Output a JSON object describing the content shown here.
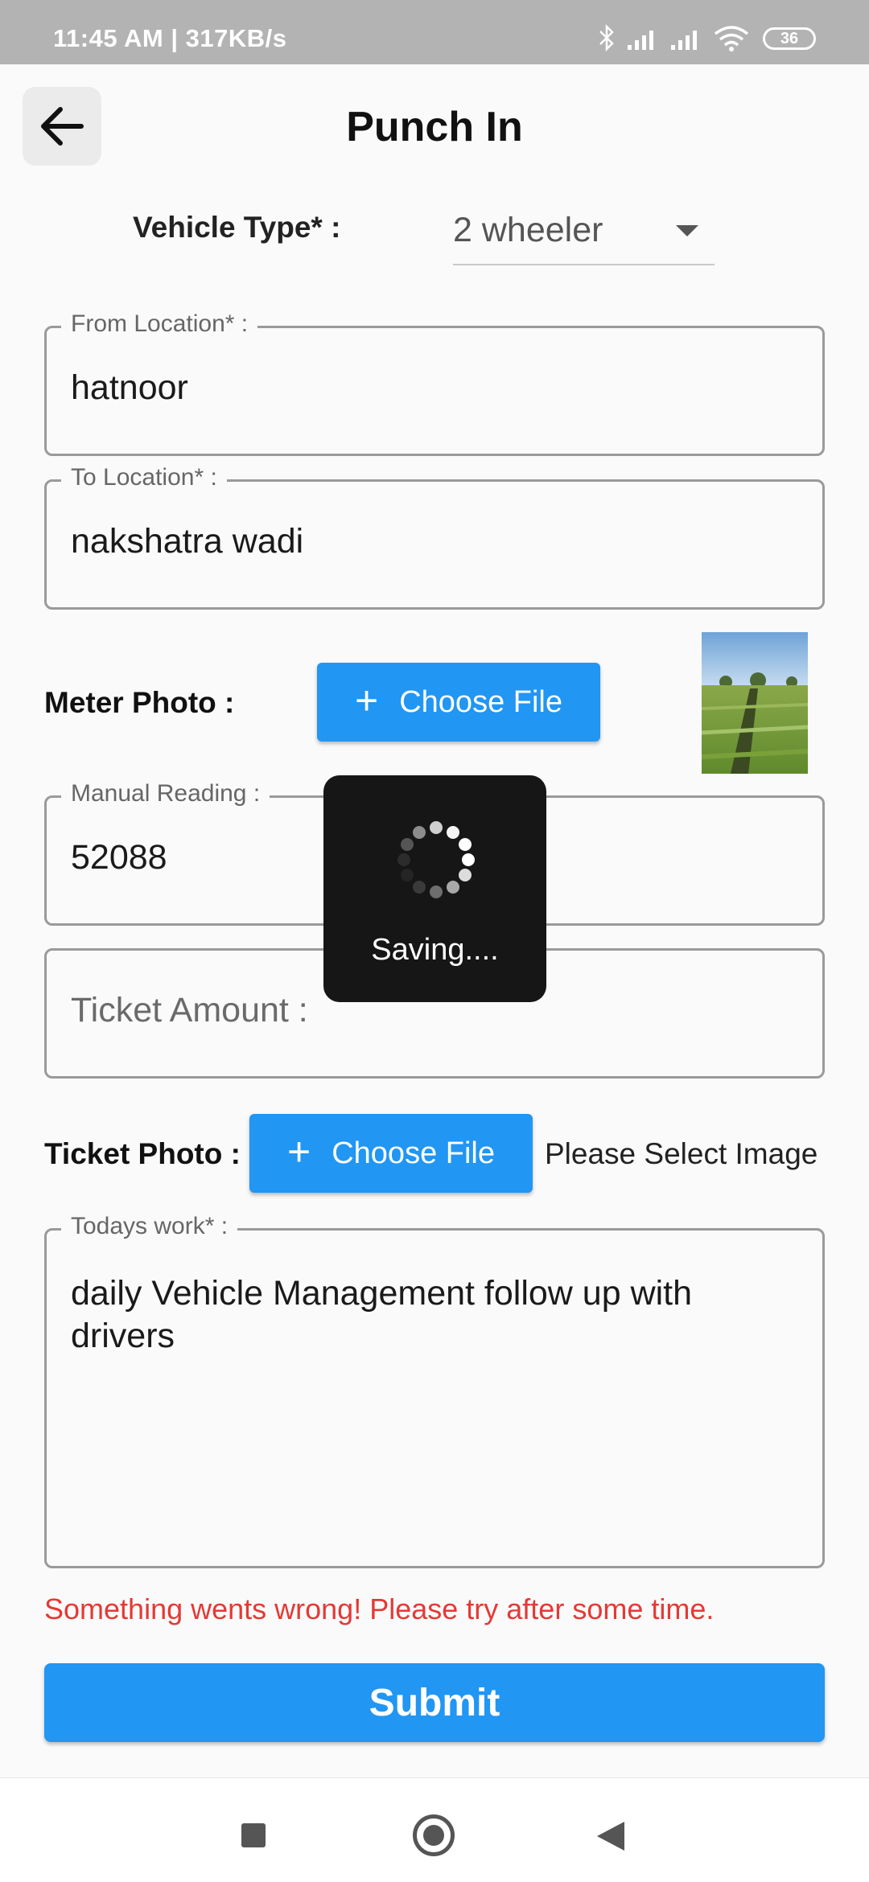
{
  "status_bar": {
    "time": "11:45 AM | 317KB/s",
    "battery": "36",
    "icons": [
      "bluetooth-icon",
      "signal-icon",
      "signal-icon",
      "wifi-icon",
      "battery-icon"
    ]
  },
  "header": {
    "title": "Punch In",
    "back_icon": "arrow-left-icon"
  },
  "vehicle": {
    "label": "Vehicle Type* :",
    "value": "2 wheeler"
  },
  "from_location": {
    "label": "From Location* :",
    "value": "hatnoor"
  },
  "to_location": {
    "label": "To Location* :",
    "value": "nakshatra wadi"
  },
  "meter_photo": {
    "label": "Meter Photo :",
    "button_label": "Choose File"
  },
  "manual_reading": {
    "label": "Manual Reading :",
    "value": "52088"
  },
  "ticket_amount": {
    "placeholder": "Ticket Amount :"
  },
  "ticket_photo": {
    "label": "Ticket Photo :",
    "button_label": "Choose File",
    "status": "Please Select Image"
  },
  "todays_work": {
    "label": "Todays work* :",
    "value": "daily Vehicle Management follow up with drivers"
  },
  "error_message": "Something wents wrong! Please try after some time.",
  "submit_label": "Submit",
  "loading": {
    "text": "Saving...."
  },
  "colors": {
    "primary": "#2196f3",
    "error": "#e53935",
    "overlay": "#161616",
    "status_bar": "#b3b3b3"
  }
}
